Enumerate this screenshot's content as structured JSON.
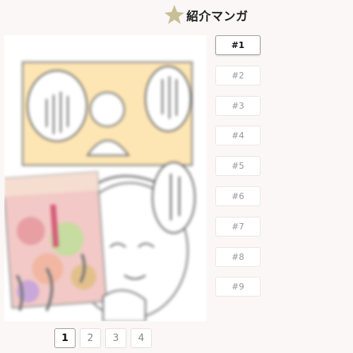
{
  "header": {
    "title": "紹介マンガ",
    "star_color": "#c9bf95",
    "star_icon": "star-icon"
  },
  "manga": {
    "bubble_texts": [
      "ポスター…ゲームキャラクター…",
      "はたらく魔少女アンソロジー!!",
      "ばーん"
    ]
  },
  "episodes": [
    "#1",
    "#2",
    "#3",
    "#4",
    "#5",
    "#6",
    "#7",
    "#8",
    "#9"
  ],
  "active_episode": "#1",
  "pagination": {
    "pages": [
      "1",
      "2",
      "3",
      "4"
    ],
    "active": "1"
  }
}
